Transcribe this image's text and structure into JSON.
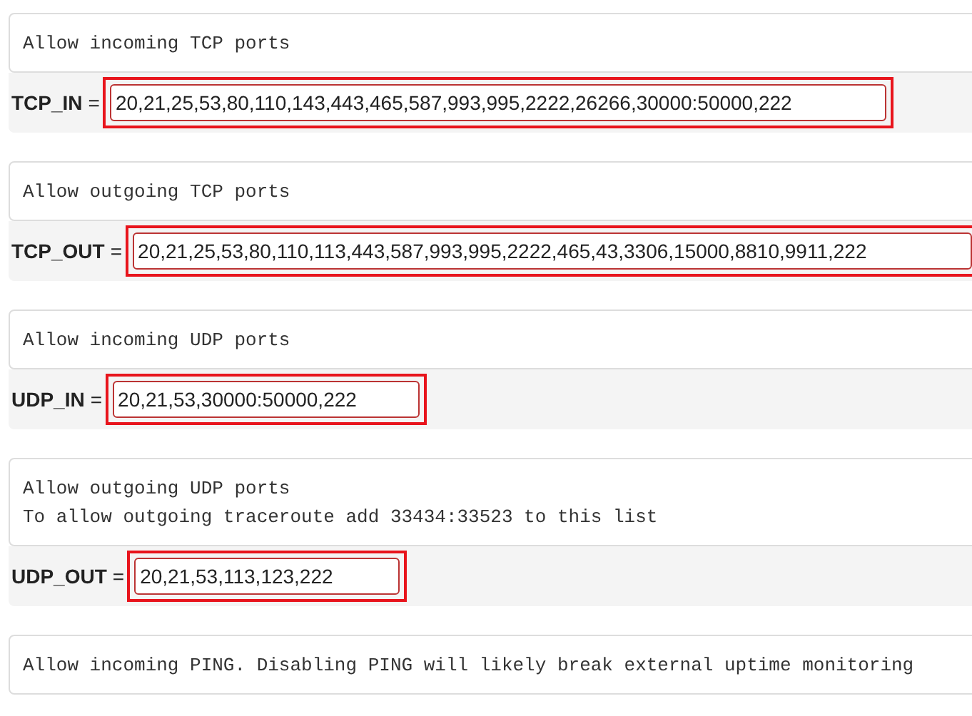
{
  "sections": [
    {
      "comment": [
        "Allow incoming TCP ports"
      ],
      "setting": {
        "name": "TCP_IN",
        "equals": "=",
        "value": "20,21,25,53,80,110,143,443,465,587,993,995,2222,26266,30000:50000,222",
        "highlighted": true
      }
    },
    {
      "comment": [
        "Allow outgoing TCP ports"
      ],
      "setting": {
        "name": "TCP_OUT",
        "equals": "=",
        "value": "20,21,25,53,80,110,113,443,587,993,995,2222,465,43,3306,15000,8810,9911,222",
        "highlighted": true
      }
    },
    {
      "comment": [
        "Allow incoming UDP ports"
      ],
      "setting": {
        "name": "UDP_IN",
        "equals": "=",
        "value": "20,21,53,30000:50000,222",
        "highlighted": true
      }
    },
    {
      "comment": [
        "Allow outgoing UDP ports",
        "To allow outgoing traceroute add 33434:33523 to this list"
      ],
      "setting": {
        "name": "UDP_OUT",
        "equals": "=",
        "value": "20,21,53,113,123,222",
        "highlighted": true
      }
    },
    {
      "comment": [
        "Allow incoming PING. Disabling PING will likely break external uptime monitoring"
      ]
    }
  ]
}
